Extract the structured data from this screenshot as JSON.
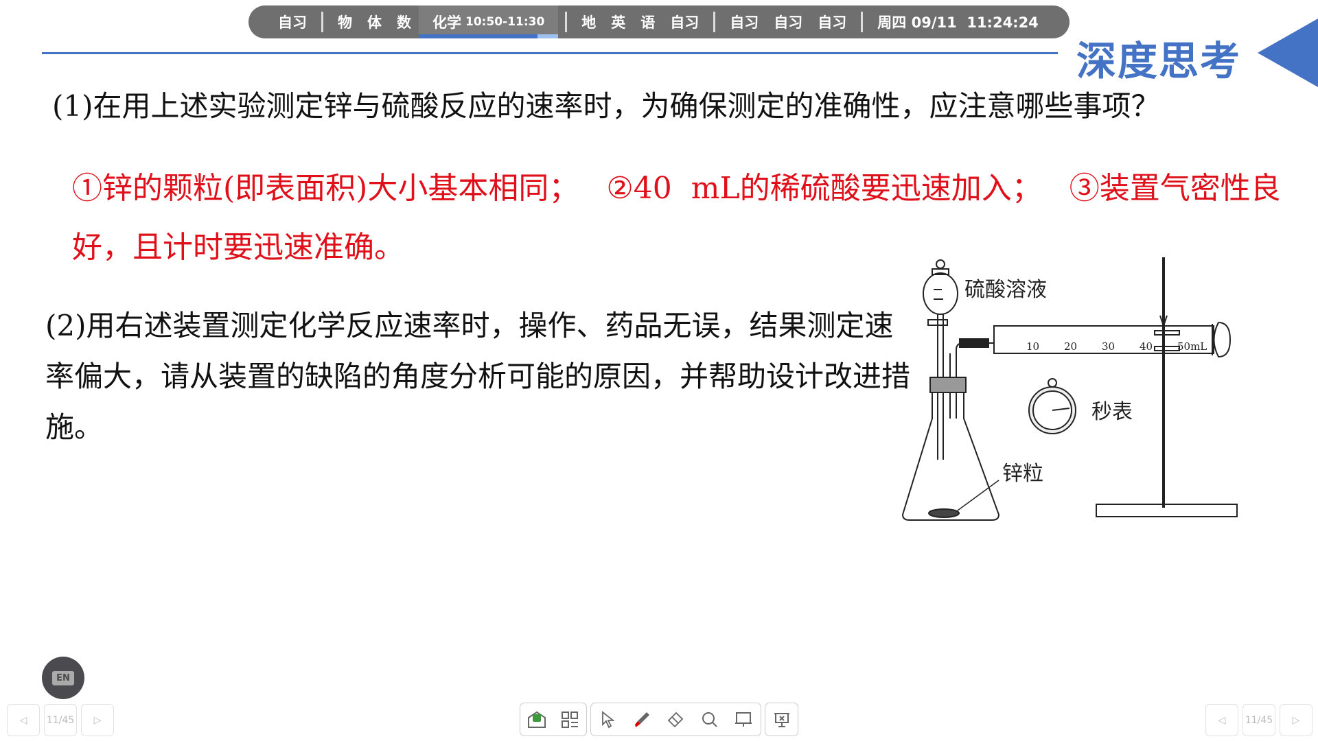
{
  "schedule": {
    "items_a": [
      "自习"
    ],
    "items_b": [
      "物",
      "体",
      "数"
    ],
    "current": {
      "subject": "化学",
      "time": "10:50-11:30",
      "progress": 0.85
    },
    "items_c": [
      "地",
      "英",
      "语",
      "自习"
    ],
    "items_d": [
      "自习",
      "自习",
      "自习"
    ],
    "datetime": "周四 09/11  11:24:24"
  },
  "slide": {
    "brand_title": "深度思考",
    "q1": "(1)在用上述实验测定锌与硫酸反应的速率时，为确保测定的准确性，应注意哪些事项？",
    "answers": [
      "①锌的颗粒(即表面积)大小基本相同；",
      "②40  mL的稀硫酸要迅速加入；",
      "③装置气密性良好，且计时要迅速准确。"
    ],
    "q2": "(2)用右述装置测定化学反应速率时，操作、药品无误，结果测定速率偏大，请从装置的缺陷的角度分析可能的原因，并帮助设计改进措施。",
    "diagram": {
      "label_acid": "硫酸溶液",
      "label_watch": "秒表",
      "label_zinc": "锌粒",
      "scale": [
        "10",
        "20",
        "30",
        "40",
        "50mL"
      ]
    }
  },
  "controls": {
    "lang_button": "EN",
    "page_left": "11/45",
    "page_right": "11/45"
  },
  "colors": {
    "accent": "#4472c4",
    "answer": "#e0101a",
    "bar": "#6f6f6f"
  }
}
